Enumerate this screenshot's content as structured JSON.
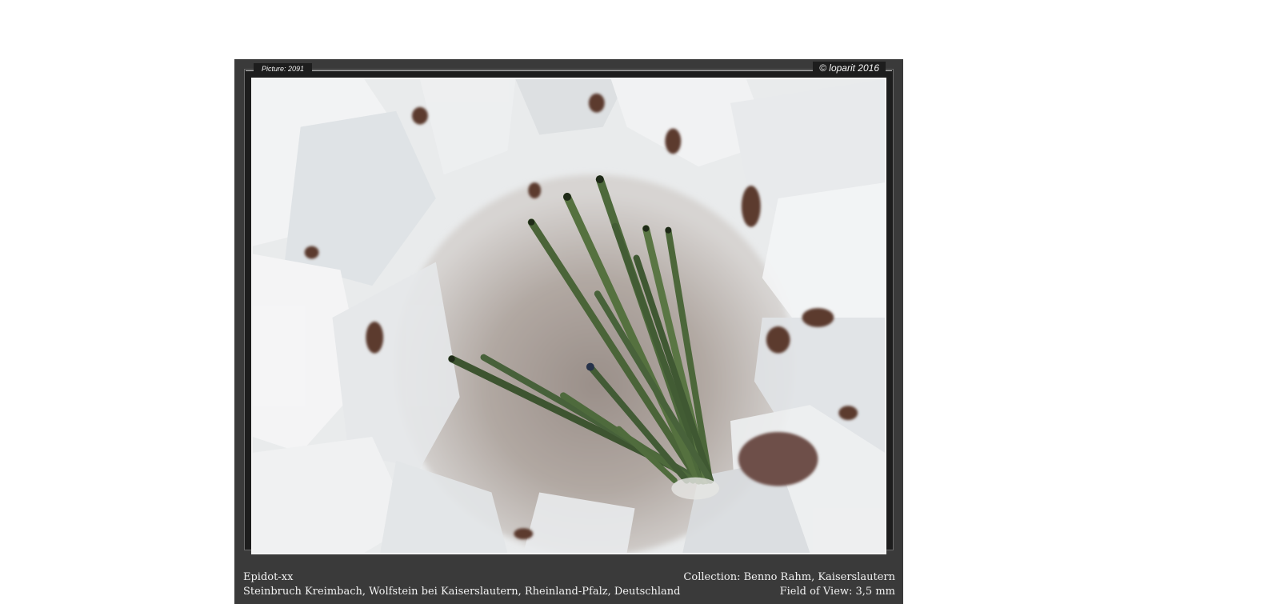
{
  "picture_number": "Picture: 2091",
  "copyright": "© loparit 2016",
  "mineral": "Epidot-xx",
  "locality": "Steinbruch Kreimbach, Wolfstein bei Kaiserslautern, Rheinland-Pfalz, Deutschland",
  "collection": "Collection:  Benno Rahm, Kaiserslautern",
  "field_of_view": "Field of View: 3,5 mm",
  "colors": {
    "frame": "#3a3a3a",
    "crystal_green": "#4f6a3b",
    "quartz": "#eceeee",
    "cavity": "#a59a93"
  }
}
